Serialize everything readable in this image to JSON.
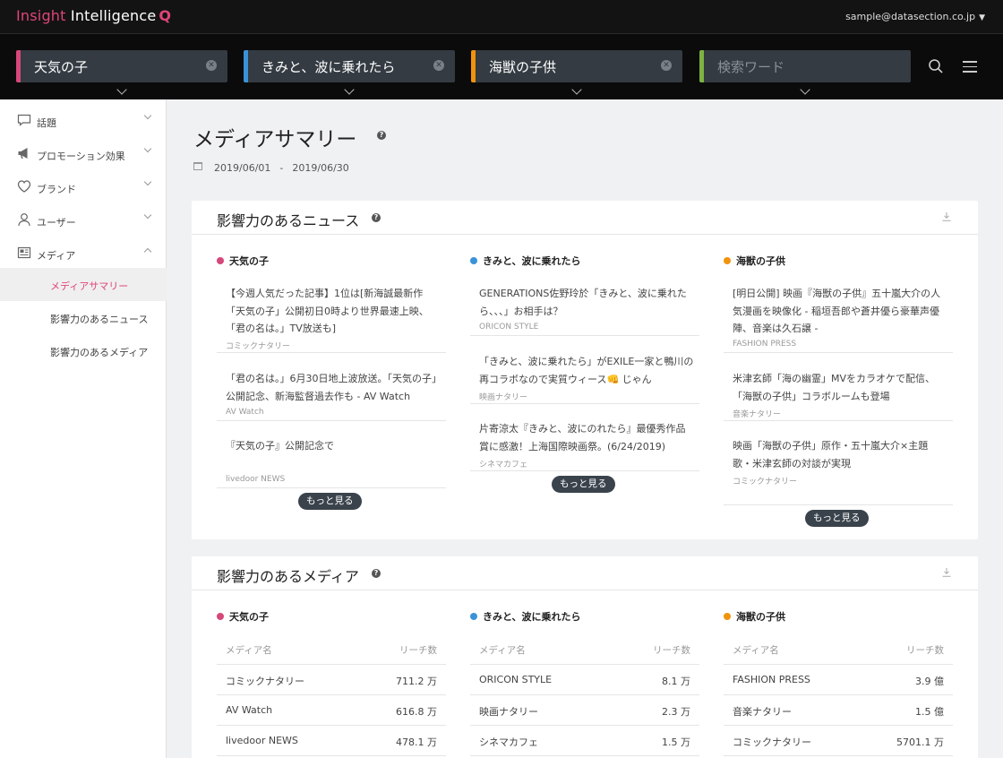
{
  "app": {
    "logo_part1": "Insight",
    "logo_part2": " Intelligence",
    "logo_q": "Q",
    "user_email": "sample@datasection.co.jp"
  },
  "search": {
    "chips": [
      {
        "label": "天気の子",
        "color": "#d6477a"
      },
      {
        "label": "きみと、波に乗れたら",
        "color": "#3a93d9"
      },
      {
        "label": "海獣の子供",
        "color": "#f0930d"
      }
    ],
    "placeholder": "検索ワード",
    "placeholder_color": "#7cb342"
  },
  "sidebar": {
    "items": [
      {
        "label": "話題",
        "icon": "speech-bubble-icon"
      },
      {
        "label": "プロモーション効果",
        "icon": "megaphone-icon"
      },
      {
        "label": "ブランド",
        "icon": "heart-icon"
      },
      {
        "label": "ユーザー",
        "icon": "user-icon"
      },
      {
        "label": "メディア",
        "icon": "newspaper-icon"
      }
    ],
    "subitems": [
      {
        "label": "メディアサマリー",
        "active": true
      },
      {
        "label": "影響力のあるニュース"
      },
      {
        "label": "影響力のあるメディア"
      }
    ]
  },
  "page": {
    "title": "メディアサマリー",
    "help": "?",
    "date_from": "2019/06/01",
    "date_sep": "-",
    "date_to": "2019/06/30"
  },
  "news_card": {
    "title": "影響力のあるニュース",
    "more_label": "もっと見る",
    "columns": [
      {
        "name": "天気の子",
        "color": "#d6477a",
        "items": [
          {
            "title": "【今週人気だった記事】1位は[新海誠最新作「天気の子」公開初日0時より世界最速上映、「君の名は。」TV放送も]",
            "source": "コミックナタリー"
          },
          {
            "title": "「君の名は。」6月30日地上波放送。「天気の子」公開記念、新海監督過去作も - AV Watch",
            "source": "AV Watch"
          },
          {
            "title": "『天気の子』公開記念で",
            "source": "livedoor NEWS"
          }
        ]
      },
      {
        "name": "きみと、波に乗れたら",
        "color": "#3a93d9",
        "items": [
          {
            "title": "GENERATIONS佐野玲於「きみと、波に乗れたら、、、」お相手は？",
            "source": "ORICON STYLE"
          },
          {
            "title": "「きみと、波に乗れたら」がEXILE一家と鴨川の再コラボなので実質ウィース👊 じゃん",
            "source": "映画ナタリー"
          },
          {
            "title": "片寄涼太『きみと、波にのれたら』最優秀作品賞に感激！上海国際映画祭。(6/24/2019)",
            "source": "シネマカフェ"
          }
        ]
      },
      {
        "name": "海獣の子供",
        "color": "#f0930d",
        "items": [
          {
            "title": "[明日公開] 映画『海獣の子供』五十嵐大介の人気漫画を映像化 - 稲垣吾郎や蒼井優ら豪華声優陣、音楽は久石譲 -",
            "source": "FASHION PRESS"
          },
          {
            "title": "米津玄師「海の幽霊」MVをカラオケで配信、「海獣の子供」コラボルームも登場",
            "source": "音楽ナタリー"
          },
          {
            "title": "映画「海獣の子供」原作・五十嵐大介×主題歌・米津玄師の対談が実現",
            "source": "コミックナタリー"
          }
        ]
      }
    ]
  },
  "media_card": {
    "title": "影響力のあるメディア",
    "col_media": "メディア名",
    "col_reach": "リーチ数",
    "columns": [
      {
        "name": "天気の子",
        "color": "#d6477a",
        "rows": [
          {
            "media": "コミックナタリー",
            "reach": "711.2 万"
          },
          {
            "media": "AV Watch",
            "reach": "616.8 万"
          },
          {
            "media": "livedoor NEWS",
            "reach": "478.1 万"
          }
        ]
      },
      {
        "name": "きみと、波に乗れたら",
        "color": "#3a93d9",
        "rows": [
          {
            "media": "ORICON STYLE",
            "reach": "8.1 万"
          },
          {
            "media": "映画ナタリー",
            "reach": "2.3 万"
          },
          {
            "media": "シネマカフェ",
            "reach": "1.5 万"
          }
        ]
      },
      {
        "name": "海獣の子供",
        "color": "#f0930d",
        "rows": [
          {
            "media": "FASHION PRESS",
            "reach": "3.9 億"
          },
          {
            "media": "音楽ナタリー",
            "reach": "1.5 億"
          },
          {
            "media": "コミックナタリー",
            "reach": "5701.1 万"
          }
        ]
      }
    ]
  }
}
